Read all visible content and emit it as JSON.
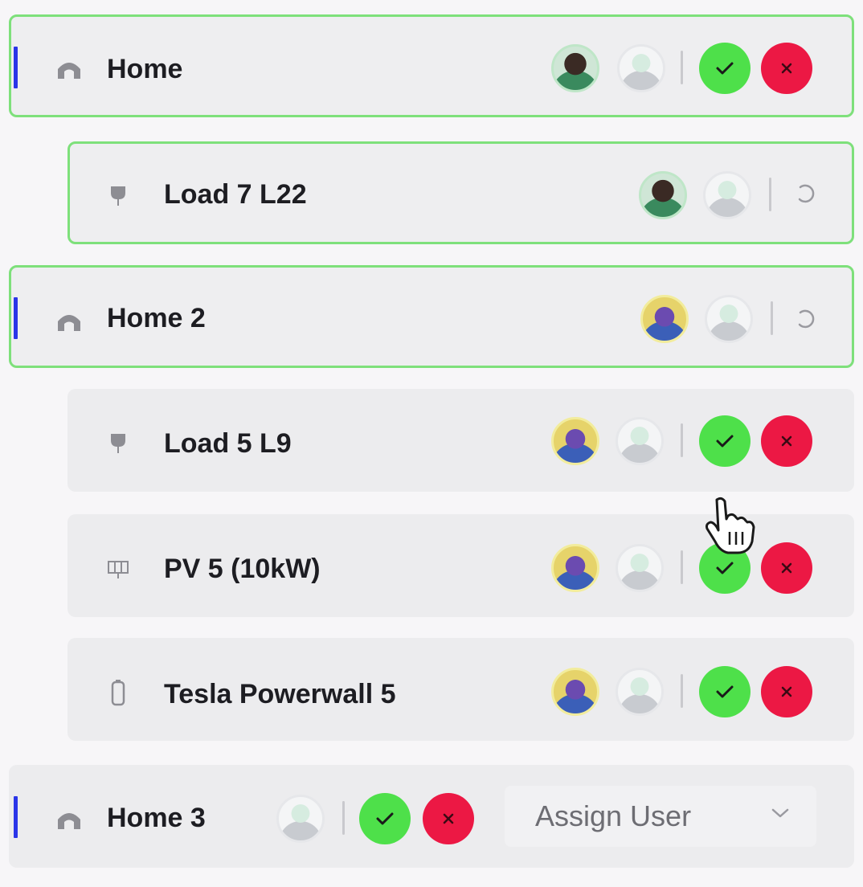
{
  "accent_color": "#2a35e8",
  "selected_border_color": "#7ee07b",
  "approve_color": "#4ee04a",
  "reject_color": "#ec1844",
  "rows": [
    {
      "label": "Home",
      "icon": "home-icon",
      "selected": true,
      "status": "pending-approval"
    },
    {
      "label": "Load 7 L22",
      "icon": "plug-icon",
      "selected": true,
      "status": "loading"
    },
    {
      "label": "Home 2",
      "icon": "home-icon",
      "selected": true,
      "status": "loading"
    },
    {
      "label": "Load 5 L9",
      "icon": "plug-icon",
      "selected": false,
      "status": "pending-approval"
    },
    {
      "label": "PV 5 (10kW)",
      "icon": "solar-panel-icon",
      "selected": false,
      "status": "pending-approval"
    },
    {
      "label": "Tesla Powerwall 5",
      "icon": "battery-icon",
      "selected": false,
      "status": "pending-approval"
    },
    {
      "label": "Home 3",
      "icon": "home-icon",
      "selected": false,
      "status": "pending-approval"
    }
  ],
  "assign_user": {
    "value": "Assign User"
  }
}
